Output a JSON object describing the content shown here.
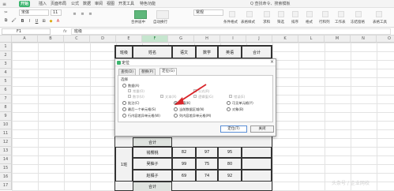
{
  "ribbon": {
    "menu_glyph": "≡",
    "tabs": [
      "开始",
      "插入",
      "页面布局",
      "公式",
      "数据",
      "审阅",
      "视图",
      "开发工具",
      "特色功能"
    ],
    "active_tab": "开始",
    "search_text": "Q 查找命令、搜索模板"
  },
  "toolbar": {
    "font_name": "宋体",
    "font_size": "11",
    "number_format": "常规",
    "merge_label": "合并居中",
    "wrap_label": "自动换行",
    "format_labels": [
      "条件格式",
      "表格样式",
      "求和",
      "筛选",
      "排序",
      "格式",
      "行和列",
      "工作表",
      "冻结窗格",
      "表格工具"
    ],
    "icons": [
      "cut-icon",
      "copy-icon",
      "format-painter-icon",
      "bold-icon",
      "italic-icon",
      "underline-icon",
      "border-icon",
      "fill-color-icon",
      "font-color-icon",
      "align-left-icon",
      "align-center-icon",
      "align-right-icon"
    ]
  },
  "formula_bar": {
    "name_box": "F1",
    "fx_symbol": "fx",
    "content": "班级"
  },
  "sheet": {
    "columns": [
      "A",
      "B",
      "C",
      "D",
      "E",
      "F",
      "G",
      "H",
      "I",
      "J",
      "K",
      "L",
      "M",
      "N",
      "O",
      "P"
    ],
    "rows": [
      "1",
      "2",
      "3",
      "4",
      "5",
      "6",
      "7",
      "8",
      "9",
      "10",
      "11",
      "12",
      "13",
      "14",
      "15",
      "16",
      "17"
    ],
    "table_header": [
      "班级",
      "姓名",
      "语文",
      "数学",
      "英语",
      "合计"
    ],
    "class_label": "1班",
    "total_label": "合计",
    "visible_rows": [
      [
        "钱樱桃",
        "82",
        "97",
        "95"
      ],
      [
        "吴柚子",
        "99",
        "75",
        "80"
      ],
      [
        "赵橘子",
        "69",
        "74",
        "92"
      ]
    ]
  },
  "dialog": {
    "title": "定位",
    "close_glyph": "×",
    "tabs": [
      "查找(D)",
      "替换(P)",
      "定位(G)"
    ],
    "active_tab": "定位(G)",
    "group_label": "选择",
    "options": [
      {
        "label": "数据(A)",
        "type": "radio",
        "checked": false,
        "disabled": false
      },
      {
        "label": "常量(O)",
        "type": "check",
        "disabled": true
      },
      {
        "label": "数字(U)",
        "type": "check",
        "disabled": true
      },
      {
        "label": "文本(X)",
        "type": "check",
        "disabled": true
      },
      {
        "label": "逻辑值(G)",
        "type": "check",
        "disabled": true
      },
      {
        "label": "错误(E)",
        "type": "check",
        "disabled": true
      },
      {
        "label": "公式(R)",
        "type": "check",
        "disabled": true
      },
      {
        "label": "批注(C)",
        "type": "radio",
        "checked": false,
        "disabled": false
      },
      {
        "label": "空值(K)",
        "type": "radio",
        "checked": true,
        "disabled": false
      },
      {
        "label": "可见单元格(Y)",
        "type": "radio",
        "checked": false,
        "disabled": false
      },
      {
        "label": "最后一个单元格(S)",
        "type": "radio",
        "checked": false,
        "disabled": false
      },
      {
        "label": "当前数据区域(N)",
        "type": "radio",
        "checked": false,
        "disabled": false
      },
      {
        "label": "对象(B)",
        "type": "radio",
        "checked": false,
        "disabled": false
      },
      {
        "label": "行内容差异单元格(W)",
        "type": "radio",
        "checked": false,
        "disabled": false
      },
      {
        "label": "列内容差异单元格(M)",
        "type": "radio",
        "checked": false,
        "disabled": false
      }
    ],
    "buttons": {
      "locate": "定位(T)",
      "close": "关闭"
    }
  },
  "watermark": "头条号 / 企业网校",
  "colors": {
    "accent": "#3db56f",
    "selected_col": "#c6e6cf",
    "arrow": "#d9262b"
  }
}
